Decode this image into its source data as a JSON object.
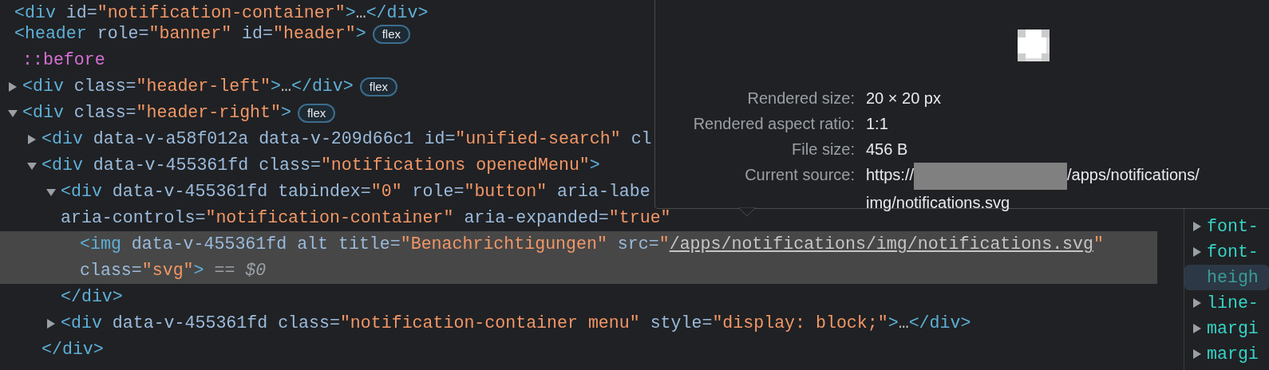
{
  "elements_tree": [
    {
      "open": [
        [
          {
            "kind": "tag",
            "text": "<div"
          },
          {
            "kind": "attr",
            "text": " id="
          },
          {
            "kind": "value",
            "text": "\"notification-container\""
          },
          {
            "kind": "tag",
            "text": ">"
          },
          {
            "kind": "text",
            "text": "…"
          },
          {
            "kind": "tag",
            "text": "</div>"
          }
        ]
      ],
      "selected": false
    },
    {
      "open": [
        [
          {
            "kind": "tag",
            "text": "<header"
          },
          {
            "kind": "attr",
            "text": " role="
          },
          {
            "kind": "value",
            "text": "\"banner\""
          },
          {
            "kind": "attr",
            "text": " id="
          },
          {
            "kind": "value",
            "text": "\"header\""
          },
          {
            "kind": "tag",
            "text": ">"
          }
        ]
      ],
      "badge": "flex",
      "selected": false,
      "children": [
        {
          "open": [
            [
              {
                "kind": "pseudo",
                "text": "::before"
              }
            ]
          ],
          "selected": false
        },
        {
          "open": [
            [
              {
                "kind": "tag",
                "text": "<div"
              },
              {
                "kind": "attr",
                "text": " class="
              },
              {
                "kind": "value",
                "text": "\"header-left\""
              },
              {
                "kind": "tag",
                "text": ">"
              },
              {
                "kind": "text",
                "text": "…"
              },
              {
                "kind": "tag",
                "text": "</div>"
              }
            ]
          ],
          "expanded": false,
          "badge": "flex",
          "selected": false
        },
        {
          "open": [
            [
              {
                "kind": "tag",
                "text": "<div"
              },
              {
                "kind": "attr",
                "text": " class="
              },
              {
                "kind": "value",
                "text": "\"header-right\""
              },
              {
                "kind": "tag",
                "text": ">"
              }
            ]
          ],
          "expanded": true,
          "badge": "flex",
          "selected": false,
          "children": [
            {
              "open": [
                [
                  {
                    "kind": "tag",
                    "text": "<div"
                  },
                  {
                    "kind": "attr",
                    "text": " data-v-a58f012a data-v-209d66c1 id="
                  },
                  {
                    "kind": "value",
                    "text": "\"unified-search\""
                  },
                  {
                    "kind": "attr",
                    "text": " cl"
                  }
                ]
              ],
              "expanded": false,
              "selected": false
            },
            {
              "open": [
                [
                  {
                    "kind": "tag",
                    "text": "<div"
                  },
                  {
                    "kind": "attr",
                    "text": " data-v-455361fd class="
                  },
                  {
                    "kind": "value",
                    "text": "\"notifications openedMenu\""
                  },
                  {
                    "kind": "tag",
                    "text": ">"
                  }
                ]
              ],
              "expanded": true,
              "selected": false,
              "children": [
                {
                  "open": [
                    [
                      {
                        "kind": "tag",
                        "text": "<div"
                      },
                      {
                        "kind": "attr",
                        "text": " data-v-455361fd tabindex="
                      },
                      {
                        "kind": "value",
                        "text": "\"0\""
                      },
                      {
                        "kind": "attr",
                        "text": " role="
                      },
                      {
                        "kind": "value",
                        "text": "\"button\""
                      },
                      {
                        "kind": "attr",
                        "text": " aria-labe"
                      }
                    ],
                    [
                      {
                        "kind": "attr",
                        "text": "aria-controls="
                      },
                      {
                        "kind": "value",
                        "text": "\"notification-container\""
                      },
                      {
                        "kind": "attr",
                        "text": " aria-expanded="
                      },
                      {
                        "kind": "value",
                        "text": "\"true\""
                      }
                    ]
                  ],
                  "expanded": true,
                  "selected": false,
                  "children": [
                    {
                      "open": [
                        [
                          {
                            "kind": "tag",
                            "text": "<img"
                          },
                          {
                            "kind": "attr",
                            "text": " data-v-455361fd alt title="
                          },
                          {
                            "kind": "value",
                            "text": "\"Benachrichtigungen\""
                          },
                          {
                            "kind": "attr",
                            "text": " src="
                          },
                          {
                            "kind": "value",
                            "text": "\""
                          },
                          {
                            "kind": "link",
                            "text": "/apps/notifications/img/notifications.svg"
                          },
                          {
                            "kind": "value",
                            "text": "\""
                          }
                        ],
                        [
                          {
                            "kind": "attr",
                            "text": "class="
                          },
                          {
                            "kind": "value",
                            "text": "\"svg\""
                          },
                          {
                            "kind": "tag",
                            "text": ">"
                          },
                          {
                            "kind": "hint",
                            "text": " == $0"
                          }
                        ]
                      ],
                      "selected": true
                    }
                  ],
                  "close": [
                    {
                      "kind": "tag",
                      "text": "</div>"
                    }
                  ]
                },
                {
                  "open": [
                    [
                      {
                        "kind": "tag",
                        "text": "<div"
                      },
                      {
                        "kind": "attr",
                        "text": " data-v-455361fd class="
                      },
                      {
                        "kind": "value",
                        "text": "\"notification-container menu\""
                      },
                      {
                        "kind": "attr",
                        "text": " style="
                      },
                      {
                        "kind": "value",
                        "text": "\"display: block;\""
                      },
                      {
                        "kind": "tag",
                        "text": ">"
                      },
                      {
                        "kind": "text",
                        "text": "…"
                      },
                      {
                        "kind": "tag",
                        "text": "</div>"
                      }
                    ]
                  ],
                  "expanded": false,
                  "selected": false
                }
              ],
              "close": [
                {
                  "kind": "tag",
                  "text": "</div>"
                }
              ]
            }
          ]
        }
      ]
    }
  ],
  "tooltip": {
    "rows": [
      {
        "label": "Rendered size:",
        "value": [
          "20 × 20 px"
        ]
      },
      {
        "label": "Rendered aspect ratio:",
        "value": [
          "1:1"
        ]
      },
      {
        "label": "File size:",
        "value": [
          "456 B"
        ]
      },
      {
        "label": "Current source:",
        "value": [
          "https://",
          "/apps/notifications/",
          "img/notifications.svg"
        ],
        "redacted": true
      }
    ]
  },
  "styles_pane": {
    "properties": [
      {
        "name": "font-",
        "kind": "shorthand",
        "selected": false
      },
      {
        "name": "font-",
        "kind": "shorthand",
        "selected": false
      },
      {
        "name": "heigh",
        "kind": "longhand",
        "selected": true
      },
      {
        "name": "line-",
        "kind": "shorthand",
        "selected": false
      },
      {
        "name": "margi",
        "kind": "shorthand",
        "selected": false
      },
      {
        "name": "margi",
        "kind": "shorthand",
        "selected": false
      }
    ]
  }
}
